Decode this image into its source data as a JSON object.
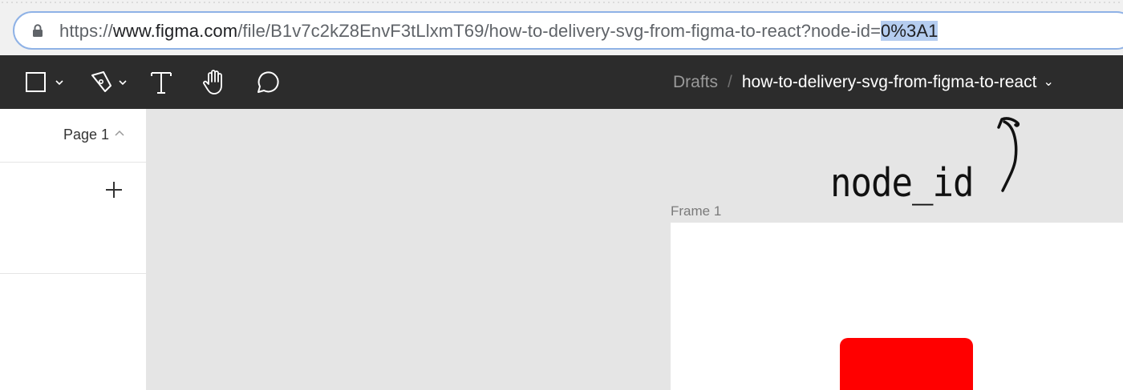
{
  "browser": {
    "url": {
      "scheme": "https://",
      "host": "www.figma.com",
      "path": "/file/B1v7c2kZ8EnvF3tLlxmT69/how-to-delivery-svg-from-figma-to-react?node-id=",
      "selected": "0%3A1"
    }
  },
  "toolbar": {
    "tools": [
      {
        "icon": "frame-rectangle-icon"
      },
      {
        "icon": "pen-icon"
      },
      {
        "icon": "text-icon"
      },
      {
        "icon": "hand-icon"
      },
      {
        "icon": "comment-icon"
      }
    ],
    "breadcrumb": {
      "drafts": "Drafts",
      "separator": "/",
      "file_name": "how-to-delivery-svg-from-figma-to-react"
    }
  },
  "left_panel": {
    "page_label": "Page 1"
  },
  "canvas": {
    "frame_label": "Frame 1",
    "background": "#e5e5e5",
    "shape_color": "#ff0000",
    "annotation": "node_id"
  }
}
